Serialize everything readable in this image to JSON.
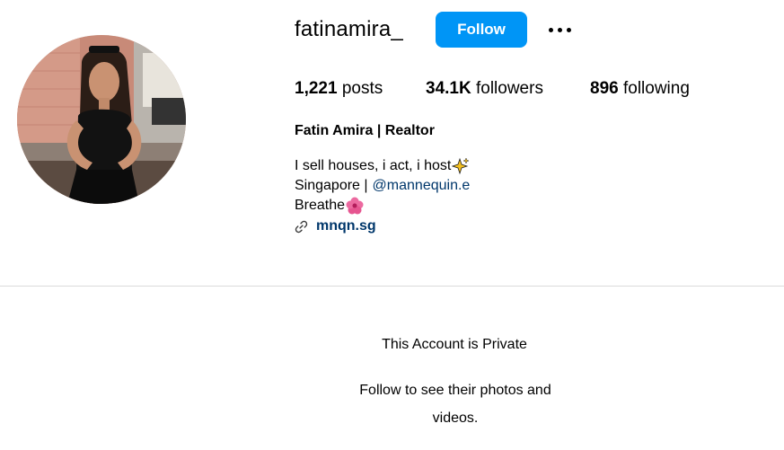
{
  "profile": {
    "username": "fatinamira_",
    "follow_label": "Follow",
    "more_icon": "more-horizontal-icon",
    "stats": {
      "posts_count": "1,221",
      "posts_label": " posts",
      "followers_count": "34.1K",
      "followers_label": " followers",
      "following_count": "896",
      "following_label": " following"
    },
    "full_name": "Fatin Amira | Realtor",
    "bio": {
      "line1": "I sell houses, i act, i host",
      "line1_emoji": "sparkles-emoji",
      "line2_text": "Singapore |",
      "line2_mention": "@mannequin.e",
      "line3": "Breathe",
      "line3_emoji": "hibiscus-emoji"
    },
    "website": "mnqn.sg",
    "link_icon": "link-icon"
  },
  "private_notice": {
    "title": "This Account is Private",
    "text": "Follow to see their photos and videos."
  },
  "colors": {
    "follow_button": "#0095f6",
    "link": "#00376b",
    "divider": "#dbdbdb"
  }
}
